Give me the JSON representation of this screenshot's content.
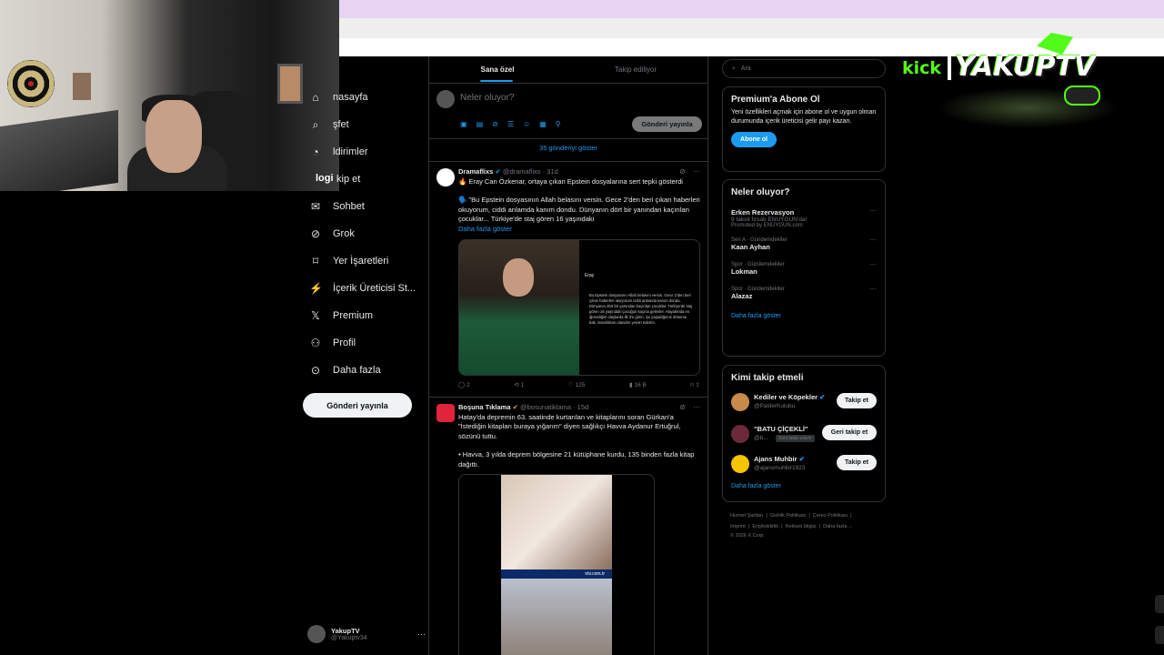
{
  "overlay": {
    "kick_text": "kick",
    "logo_text": "YAKUPTV"
  },
  "nav": {
    "items": [
      {
        "label": "nasayfa",
        "icon": "home-icon"
      },
      {
        "label": "şfet",
        "icon": "explore-icon"
      },
      {
        "label": "ldirimler",
        "icon": "bell-icon"
      },
      {
        "label": "kip et",
        "icon": "follow-icon"
      },
      {
        "label": "Sohbet",
        "icon": "mail-icon"
      },
      {
        "label": "Grok",
        "icon": "grok-icon"
      },
      {
        "label": "Yer İşaretleri",
        "icon": "bookmark-icon"
      },
      {
        "label": "İçerik Üreticisi St...",
        "icon": "creator-icon"
      },
      {
        "label": "Premium",
        "icon": "x-icon"
      },
      {
        "label": "Profil",
        "icon": "person-icon"
      },
      {
        "label": "Daha fazla",
        "icon": "more-circle-icon"
      }
    ],
    "logi_overlay": "logi",
    "post_button": "Gönderi yayınla",
    "profile": {
      "name": "YakupTV",
      "handle": "@Yakuptv34"
    }
  },
  "main": {
    "tabs": [
      "Sana özel",
      "Takip ediliyor"
    ],
    "compose_placeholder": "Neler oluyor?",
    "compose_button": "Gönderi yayınla",
    "show_more_posts": "35 gönderiyi göster",
    "posts": [
      {
        "author": "Dramaflixs",
        "handle": "@dramaflixs · 31d",
        "text1": "🔥 Eray Can Özkenar, ortaya çıkan Epstein dosyalarına sert tepki gösterdi",
        "text2": "🗣️ \"Bu Epstein dosyasının Allah belasını versin. Gece 2'den beri çıkan haberleri okuyorum, ciddi anlamda kanım dondu. Dünyanın dört bir yanından kaçırılan çocuklar... Türkiye'de staj gören 16 yaşındaki",
        "show_more": "Daha fazla göster",
        "embed_user": "Eray",
        "embed_text": "Bu Epstein dosyasının Allah belasını versin. Gece 2'den beri çıkan haberleri okuyorum ciddi anlamda kanım dondu. Dünyanın dört bir yanından kaçırılan çocuklar. Türkiye'de staj gören 16 yaşındaki çocuğun kaçına gelenler. Hayatımda en iğrendiğim olaylarda ilk 3'e giren. Şu yaşadığımız döneme bak, insanlıktan utandım yemin ederim.",
        "actions": {
          "reply": "2",
          "repost": "1",
          "like": "125",
          "views": "16 B"
        }
      },
      {
        "author": "Boşuna Tıklama",
        "handle": "@bosunatiklama · 15d",
        "text1": "Hatay'da depremin 63. saatinde kurtarılan ve kitaplarını soran Gürkan'a \"İstediğin kitapları buraya yığarım\" diyen sağlıkçı Havva Aydanur Ertuğrul, sözünü tuttu.",
        "text2": "• Havva, 3 yılda deprem bölgesine 21 kütüphane kurdu, 135 binden fazla kitap dağıttı.",
        "media_caption": "ntv.com.tr"
      }
    ]
  },
  "right": {
    "search_placeholder": "Ara",
    "premium": {
      "title": "Premium'a Abone Ol",
      "text": "Yeni özellikleri açmak için abone ol ve uygun olman durumunda içerik üreticisi gelir payı kazan.",
      "button": "Abone ol"
    },
    "trends": {
      "title": "Neler oluyor?",
      "items": [
        {
          "name": "Erken Rezervasyon",
          "sub": "9 taksit fırsatı ENUYGUN'da!",
          "meta": "Promoted by ENUYGUN.com"
        },
        {
          "meta": "Seri A · Gündemdekiler",
          "name": "Kaan Ayhan"
        },
        {
          "meta": "Spor · Gündemdekiler",
          "name": "Lokman"
        },
        {
          "meta": "Spor · Gündemdekiler",
          "name": "Alazaz"
        }
      ],
      "show_more": "Daha fazla göster"
    },
    "who_to_follow": {
      "title": "Kimi takip etmeli",
      "items": [
        {
          "name": "Kediler ve Köpekler",
          "handle": "@PatilerKulubu",
          "button": "Takip et"
        },
        {
          "name": "\"BATU ÇİÇEKLİ\"",
          "handle": "@b...",
          "badge": "Seni takip ediyor",
          "button": "Geri takip et"
        },
        {
          "name": "Ajans Muhbir",
          "handle": "@ajansmuhbir1923",
          "button": "Takip et"
        }
      ],
      "show_more": "Daha fazla göster"
    },
    "footer": {
      "line1": [
        "Hizmet Şartları",
        "Gizlilik Politikası",
        "Çerez Politikası"
      ],
      "line2": [
        "Imprint",
        "Erişilebilirlik",
        "Reklam bilgisi",
        "Daha fazla ..."
      ],
      "copyright": "© 2026 X Corp."
    }
  },
  "colors": {
    "accent": "#1d9bf0",
    "background": "#000000",
    "border": "#2f3336",
    "muted": "#71767b",
    "kick_green": "#53fc18"
  }
}
